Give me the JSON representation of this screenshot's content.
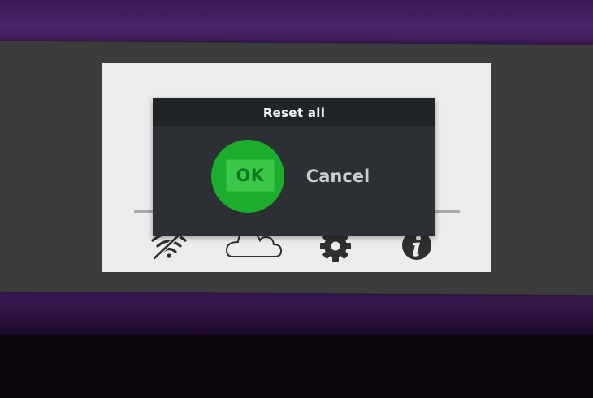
{
  "dialog": {
    "title": "Reset all",
    "ok_label": "OK",
    "cancel_label": "Cancel"
  },
  "nav_icons": [
    {
      "icon": "no-wifi-icon"
    },
    {
      "icon": "cloud-icon"
    },
    {
      "icon": "gear-icon"
    },
    {
      "icon": "info-icon"
    }
  ],
  "colors": {
    "ok_green": "#1bad2b",
    "dialog_bg": "#2c2f34",
    "titlebar_bg": "#212427",
    "screen_bg": "#ececec"
  }
}
